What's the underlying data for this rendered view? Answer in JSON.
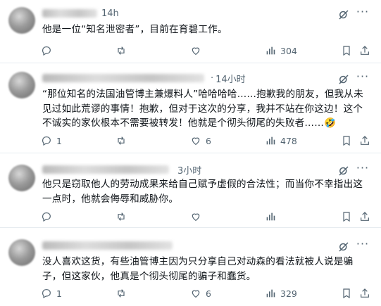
{
  "tweets": [
    {
      "time": "14h",
      "time_separator": "·",
      "text": "他是一位“知名泄密者”，目前在育碧工作。",
      "stats": {
        "replies": "",
        "retweets": "",
        "likes": "",
        "views": "304"
      }
    },
    {
      "time": "14小时",
      "time_separator": "·",
      "text": "“那位知名的法国油管博主兼爆料人”哈哈哈哈……抱歉我的朋友，但我从未见过如此荒谬的事情！抱歉，但对于这次的分享，我并不站在你这边！这个不诚实的家伙根本不需要被转发！他就是个彻头彻尾的失败者……🤣",
      "stats": {
        "replies": "1",
        "retweets": "",
        "likes": "6",
        "views": "478"
      }
    },
    {
      "time": "3小时",
      "time_separator": "",
      "text": "他只是窃取他人的劳动成果来给自己赋予虚假的合法性；而当你不幸指出这一点时，他就会侮辱和威胁你。",
      "stats": {
        "replies": "",
        "retweets": "",
        "likes": "",
        "views": ""
      }
    },
    {
      "time": "",
      "time_separator": "",
      "text": "没人喜欢这货，有些油管博主因为只分享自己对动森的看法就被人说是骗子，但这家伙，他真是个彻头彻尾的骗子和蠢货。",
      "stats": {
        "replies": "1",
        "retweets": "",
        "likes": "6",
        "views": "329"
      }
    }
  ],
  "icons": {
    "reply": "reply-icon",
    "retweet": "retweet-icon",
    "like": "heart-icon",
    "views": "views-icon",
    "bookmark": "bookmark-icon",
    "share": "share-icon",
    "grok": "grok-icon",
    "more": "more-icon"
  },
  "colors": {
    "text": "#0f1419",
    "muted": "#536471",
    "border": "#e6ecf0",
    "background": "#ffffff"
  }
}
